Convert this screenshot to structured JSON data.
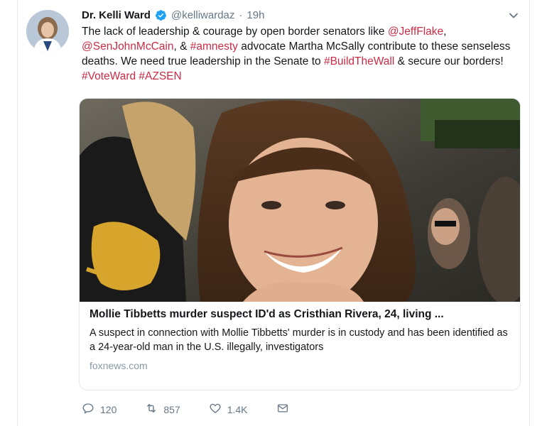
{
  "tweet": {
    "author_name": "Dr. Kelli Ward",
    "author_handle": "@kelliwardaz",
    "separator": "·",
    "time": "19h",
    "text_parts": [
      {
        "t": "The lack of leadership & courage by open border senators like ",
        "link": false
      },
      {
        "t": "@JeffFlake",
        "link": true
      },
      {
        "t": ", ",
        "link": false
      },
      {
        "t": "@SenJohnMcCain",
        "link": true
      },
      {
        "t": ", & ",
        "link": false
      },
      {
        "t": "#amnesty",
        "link": true
      },
      {
        "t": " advocate Martha McSally contribute to these senseless deaths. We need true leadership in the Senate to ",
        "link": false
      },
      {
        "t": "#BuildTheWall",
        "link": true
      },
      {
        "t": " & secure our borders! ",
        "link": false
      },
      {
        "t": "#VoteWard",
        "link": true
      },
      {
        "t": " ",
        "link": false
      },
      {
        "t": "#AZSEN",
        "link": true
      }
    ]
  },
  "card": {
    "title": "Mollie Tibbetts murder suspect ID'd as Cristhian Rivera, 24, living ...",
    "description": "A suspect in connection with Mollie Tibbetts' murder is in custody and has been identified as a 24-year-old man in the U.S. illegally, investigators",
    "domain": "foxnews.com"
  },
  "actions": {
    "replies": "120",
    "retweets": "857",
    "likes": "1.4K"
  },
  "colors": {
    "link": "#cc2b45",
    "verified": "#1da1f2",
    "muted": "#657786"
  },
  "icons": [
    "verified-badge-icon",
    "chevron-down-icon",
    "reply-icon",
    "retweet-icon",
    "like-icon",
    "direct-message-icon"
  ]
}
